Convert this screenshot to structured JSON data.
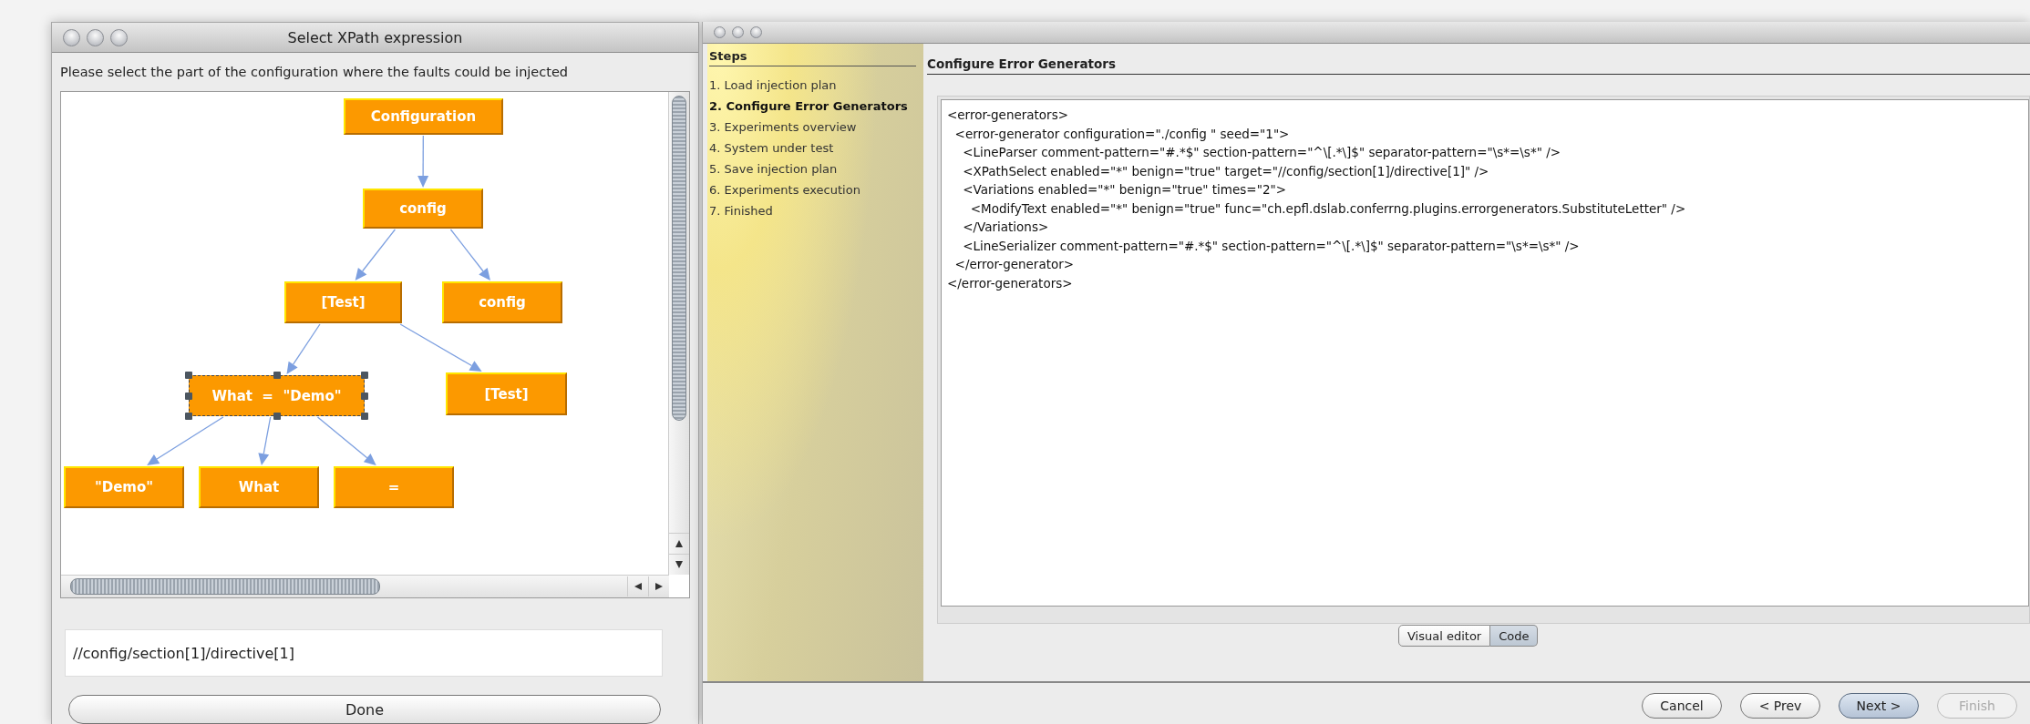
{
  "dialog": {
    "title": "Select XPath expression",
    "instruction": "Please select the part of the configuration where the faults could be injected",
    "tree": {
      "label": "Configuration",
      "selected": false,
      "children": [
        {
          "label": "config",
          "selected": false,
          "children": [
            {
              "label": "[Test]",
              "selected": false,
              "children": [
                {
                  "label": "What  =  \"Demo\"",
                  "selected": true,
                  "children": [
                    {
                      "label": "\"Demo\"",
                      "selected": false
                    },
                    {
                      "label": "What",
                      "selected": false
                    },
                    {
                      "label": "=",
                      "selected": false
                    }
                  ]
                },
                {
                  "label": "[Test]",
                  "selected": false
                }
              ]
            },
            {
              "label": "config",
              "selected": false
            }
          ]
        }
      ]
    },
    "xpath_field": {
      "value": "//config/section[1]/directive[1]"
    },
    "done_button": "Done"
  },
  "wizard": {
    "steps_title": "Steps",
    "steps": [
      {
        "label": "1. Load injection plan",
        "selected": false
      },
      {
        "label": "2. Configure Error Generators",
        "selected": true
      },
      {
        "label": "3. Experiments overview",
        "selected": false
      },
      {
        "label": "4. System under test",
        "selected": false
      },
      {
        "label": "5. Save injection plan",
        "selected": false
      },
      {
        "label": "6. Experiments execution",
        "selected": false
      },
      {
        "label": "7. Finished",
        "selected": false
      }
    ],
    "page_title": "Configure Error Generators",
    "code_lines": [
      "<error-generators>",
      "  <error-generator configuration=\"./config \" seed=\"1\">",
      "    <LineParser comment-pattern=\"#.*$\" section-pattern=\"^\\[.*\\]$\" separator-pattern=\"\\s*=\\s*\" />",
      "    <XPathSelect enabled=\"*\" benign=\"true\" target=\"//config/section[1]/directive[1]\" />",
      "    <Variations enabled=\"*\" benign=\"true\" times=\"2\">",
      "      <ModifyText enabled=\"*\" benign=\"true\" func=\"ch.epfl.dslab.conferrng.plugins.errorgenerators.SubstituteLetter\" />",
      "    </Variations>",
      "    <LineSerializer comment-pattern=\"#.*$\" section-pattern=\"^\\[.*\\]$\" separator-pattern=\"\\s*=\\s*\" />",
      "  </error-generator>",
      "</error-generators>"
    ],
    "view_toggle": [
      {
        "label": "Visual editor",
        "selected": false
      },
      {
        "label": "Code",
        "selected": true
      }
    ],
    "buttons": [
      {
        "label": "Cancel",
        "default": false,
        "disabled": false
      },
      {
        "label": "< Prev",
        "default": false,
        "disabled": false
      },
      {
        "label": "Next >",
        "default": true,
        "disabled": false
      },
      {
        "label": "Finish",
        "default": false,
        "disabled": true
      }
    ]
  }
}
